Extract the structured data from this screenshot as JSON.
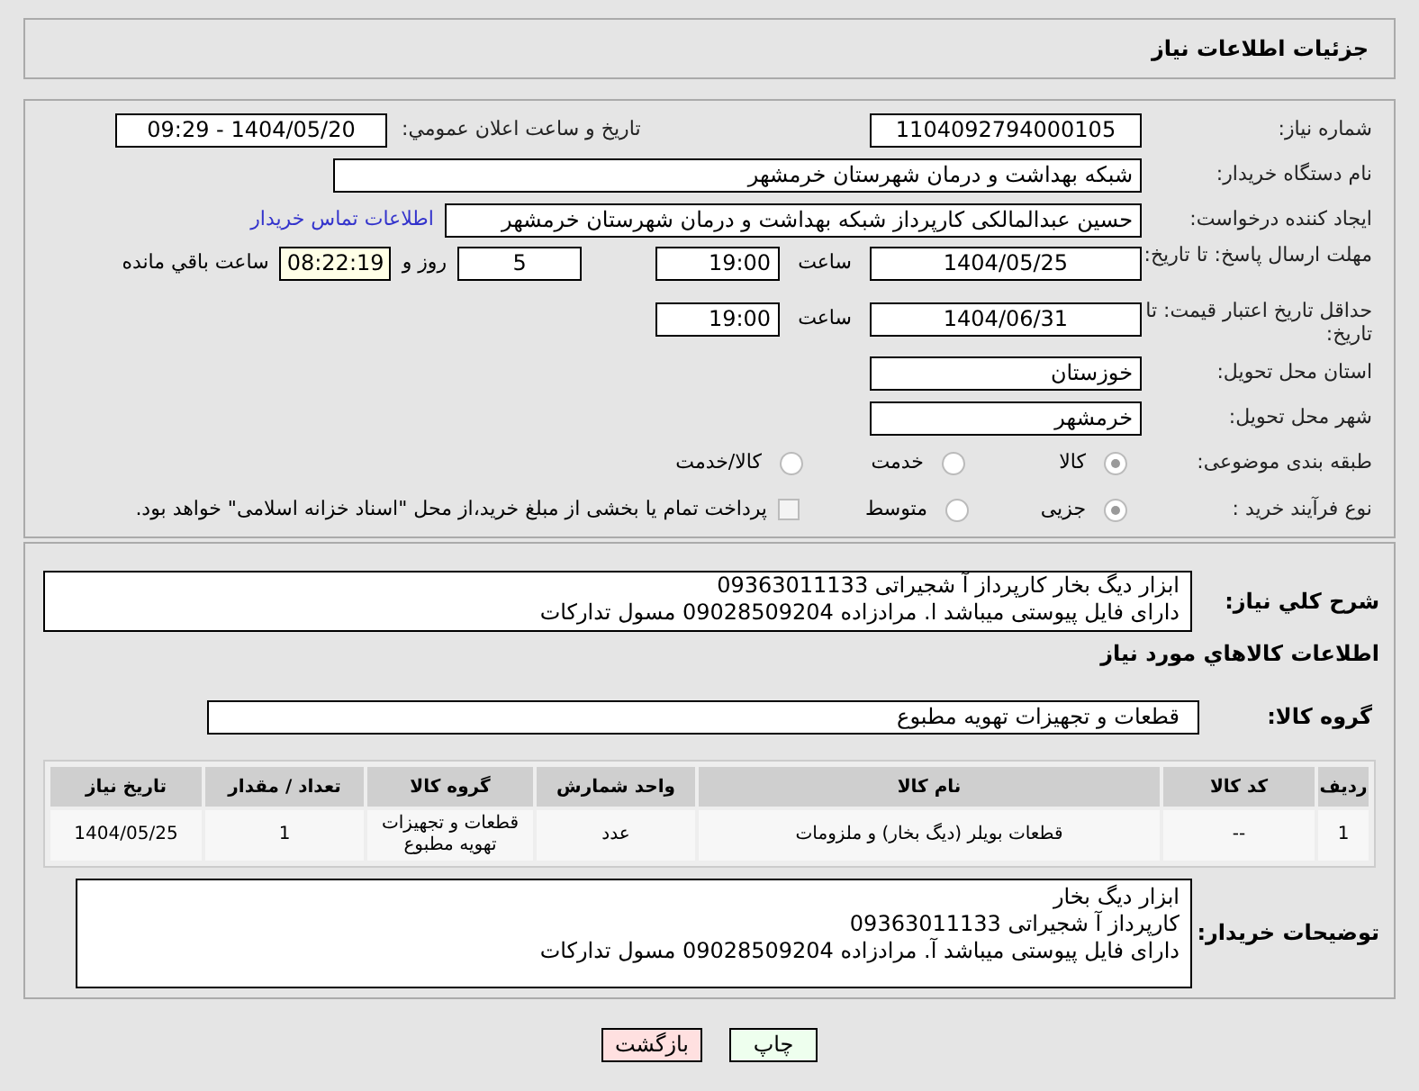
{
  "page_title": "جزئیات اطلاعات نیاز",
  "need_number": {
    "label": "شماره نیاز:",
    "value": "1104092794000105"
  },
  "announcement": {
    "label": "تاریخ و ساعت اعلان عمومي:",
    "value": "1404/05/20 - 09:29"
  },
  "buyer_org": {
    "label": "نام دستگاه خریدار:",
    "value": "شبکه بهداشت و درمان شهرستان خرمشهر"
  },
  "requester": {
    "label": "ایجاد کننده درخواست:",
    "value": "حسین عبدالمالکی کارپرداز شبکه بهداشت و درمان شهرستان خرمشهر",
    "link": "اطلاعات تماس خریدار"
  },
  "response_deadline": {
    "label": "مهلت ارسال پاسخ: تا تاریخ:",
    "date": "1404/05/25",
    "time_label": "ساعت",
    "time": "19:00",
    "days": "5",
    "days_label": "روز و",
    "remaining": "08:22:19",
    "remaining_label": "ساعت باقي مانده"
  },
  "price_validity": {
    "label": "حداقل تاریخ اعتبار قیمت: تا تاریخ:",
    "date": "1404/06/31",
    "time_label": "ساعت",
    "time": "19:00"
  },
  "province": {
    "label": "استان محل تحویل:",
    "value": "خوزستان"
  },
  "city": {
    "label": "شهر محل تحویل:",
    "value": "خرمشهر"
  },
  "category": {
    "label": "طبقه بندی موضوعی:",
    "options": [
      {
        "label": "کالا",
        "selected": true
      },
      {
        "label": "خدمت",
        "selected": false
      },
      {
        "label": "کالا/خدمت",
        "selected": false
      }
    ]
  },
  "purchase_type": {
    "label": "نوع فرآیند خرید :",
    "options": [
      {
        "label": "جزیی",
        "selected": true
      },
      {
        "label": "متوسط",
        "selected": false
      }
    ],
    "payment": {
      "label": "پرداخت تمام یا بخشی از مبلغ خرید،از محل \"اسناد خزانه اسلامی\" خواهد بود.",
      "checked": false
    }
  },
  "general_description": {
    "label": "شرح کلي نیاز:",
    "value": "ابزار دیگ بخار کارپرداز آ شجیراتی 09363011133\nدارای فایل پیوستی میباشد ا. مرادزاده 09028509204 مسول تدارکات"
  },
  "goods_section_title": "اطلاعات کالاهاي مورد نیاز",
  "goods_group": {
    "label": "گروه کالا:",
    "value": "قطعات و تجهیزات تهویه مطبوع"
  },
  "table": {
    "columns": [
      "ردیف",
      "کد کالا",
      "نام کالا",
      "واحد شمارش",
      "گروه کالا",
      "تعداد / مقدار",
      "تاریخ نیاز"
    ],
    "rows": [
      [
        "1",
        "--",
        "قطعات بویلر (دیگ بخار) و ملزومات",
        "عدد",
        "قطعات و تجهیزات تهویه مطبوع",
        "1",
        "1404/05/25"
      ]
    ]
  },
  "buyer_notes": {
    "label": "توضیحات خریدار:",
    "value": "ابزار دیگ بخار\nکارپرداز آ شجیراتی 09363011133\nدارای فایل پیوستی میباشد آ. مرادزاده 09028509204 مسول تدارکات"
  },
  "buttons": [
    {
      "label": "چاپ",
      "kind": "print"
    },
    {
      "label": "بازگشت",
      "kind": "back"
    }
  ]
}
